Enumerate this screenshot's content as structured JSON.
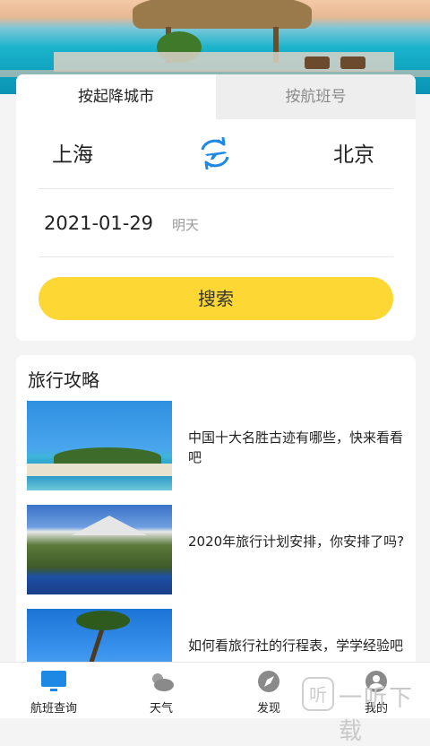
{
  "search": {
    "tabs": [
      "按起降城市",
      "按航班号"
    ],
    "from_city": "上海",
    "to_city": "北京",
    "date": "2021-01-29",
    "date_note": "明天",
    "search_button": "搜索"
  },
  "guide": {
    "title": "旅行攻略",
    "items": [
      {
        "text": "中国十大名胜古迹有哪些，快来看看吧"
      },
      {
        "text": "2020年旅行计划安排，你安排了吗?"
      },
      {
        "text": "如何看旅行社的行程表，学学经验吧"
      }
    ]
  },
  "tabbar": {
    "items": [
      {
        "label": "航班查询",
        "icon": "monitor-icon"
      },
      {
        "label": "天气",
        "icon": "weather-icon"
      },
      {
        "label": "发现",
        "icon": "compass-icon"
      },
      {
        "label": "我的",
        "icon": "user-icon"
      }
    ]
  },
  "watermark": {
    "text": "一听下载"
  },
  "colors": {
    "accent": "#fdd835",
    "brand_blue": "#1e88e5"
  }
}
